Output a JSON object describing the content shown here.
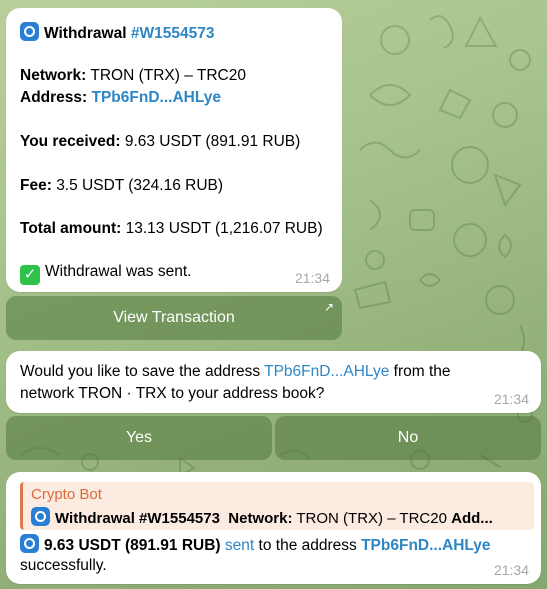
{
  "colors": {
    "link": "#2f86c5",
    "bubble": "#ffffff",
    "keyboard_button": "#5f8a4c",
    "reply_accent": "#e0774a",
    "reply_title": "#dd6a3a",
    "check_icon_bg": "#2ec24b",
    "app_icon_bg": "#2a7fd4"
  },
  "message1": {
    "icon": "crypto-bot-app-icon",
    "title": "Withdrawal",
    "id": "#W1554573",
    "network_label": "Network:",
    "network_value": "TRON (TRX) – TRC20",
    "address_label": "Address:",
    "address_value": "TPb6FnD...AHLye",
    "received_label": "You received:",
    "received_value": "9.63 USDT (891.91 RUB)",
    "fee_label": "Fee:",
    "fee_value": "3.5 USDT (324.16 RUB)",
    "total_label": "Total amount:",
    "total_value": "13.13 USDT (1,216.07 RUB)",
    "status_icon": "check-mark-icon",
    "status_text": "Withdrawal was sent.",
    "time": "21:34",
    "button_label": "View Transaction",
    "button_icon": "external-link-arrow-icon"
  },
  "message2": {
    "text_before": "Would you like to save the address ",
    "address": "TPb6FnD...AHLye",
    "text_after": " from the",
    "line2": "network TRON · TRX to your address book?",
    "time": "21:34",
    "yes_label": "Yes",
    "no_label": "No"
  },
  "message3": {
    "reply_sender": "Crypto Bot",
    "reply_title": "Withdrawal #W1554573",
    "reply_network_label": "Network:",
    "reply_network_value": "TRON (TRX) – TRC20",
    "reply_more": "Add...",
    "amount": "9.63 USDT (891.91 RUB)",
    "sent_link": "sent",
    "to_address_text": "to the address",
    "address": "TPb6FnD...AHLye",
    "line2": "successfully.",
    "time": "21:34"
  }
}
